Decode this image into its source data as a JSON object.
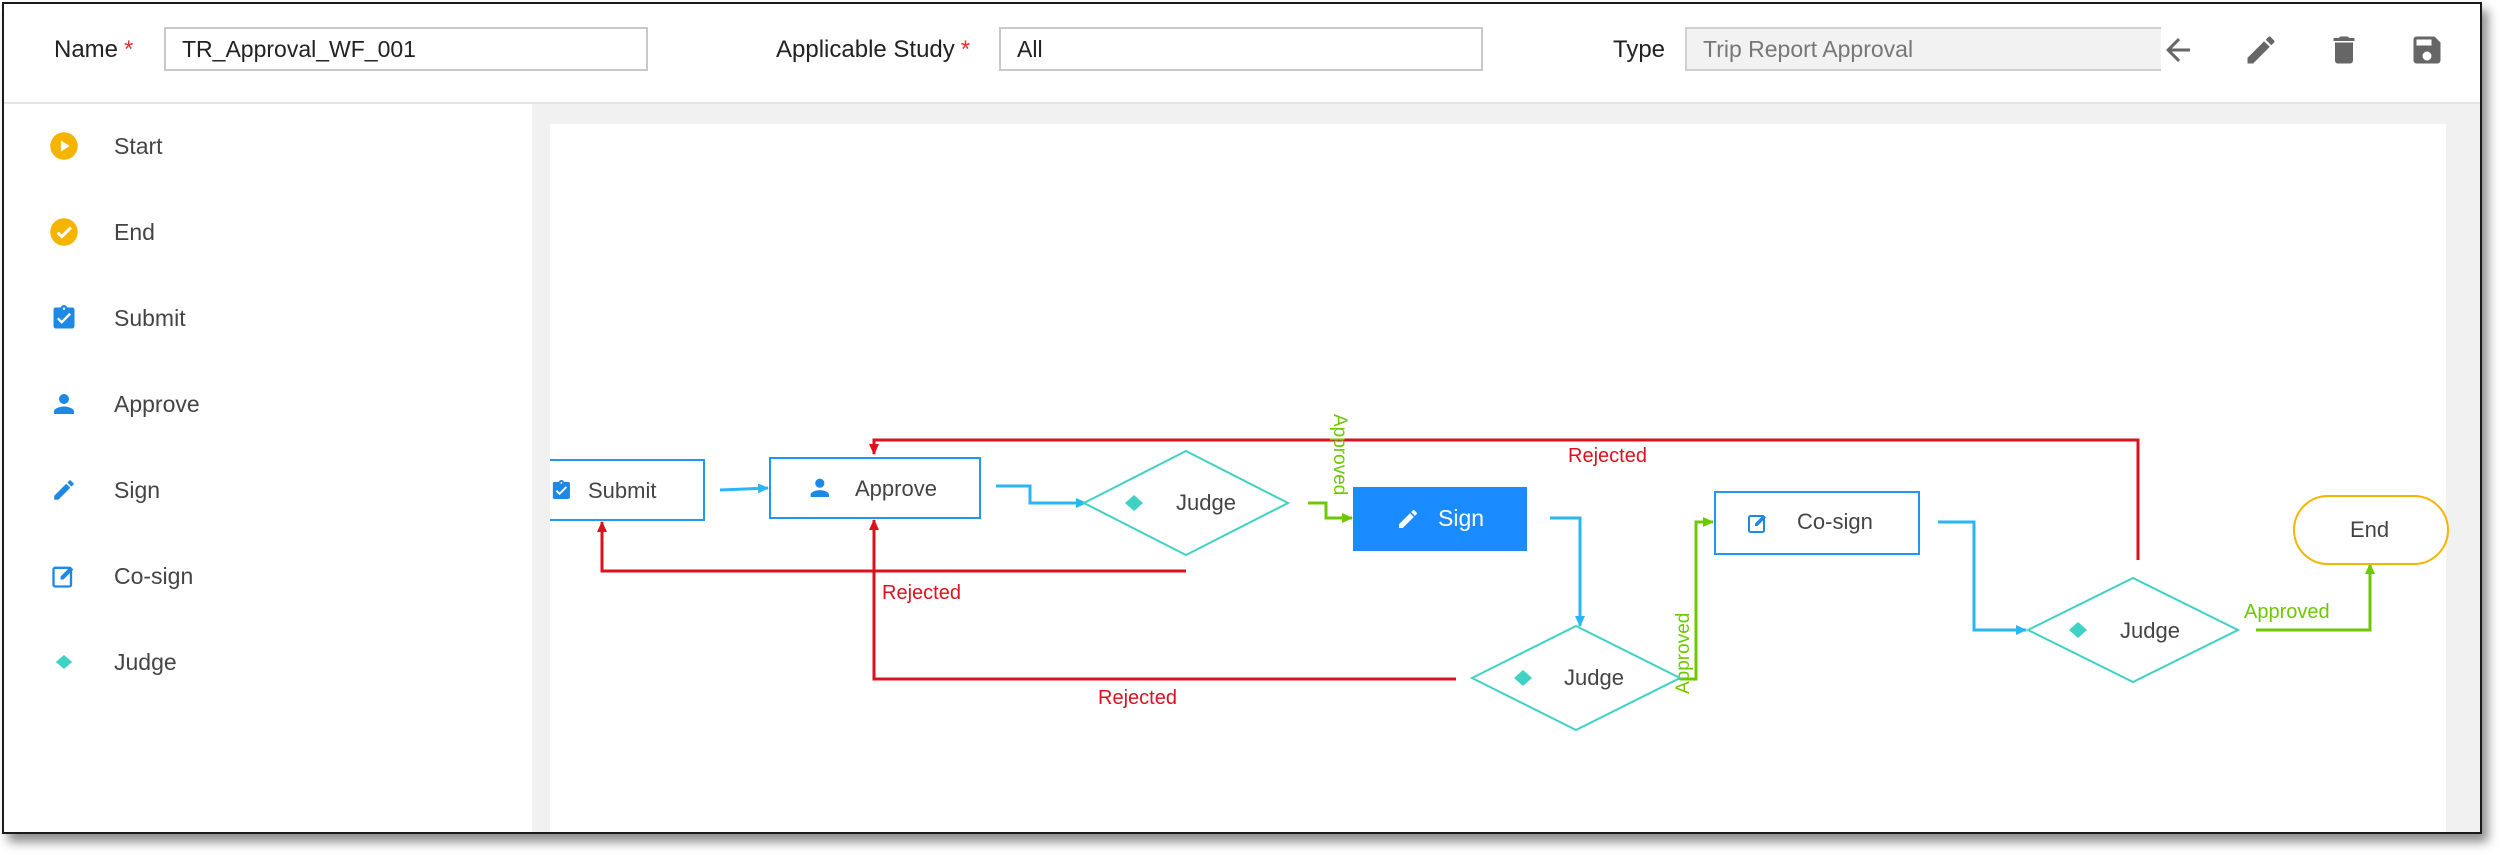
{
  "header": {
    "name_label": "Name",
    "name_value": "TR_Approval_WF_001",
    "study_label": "Applicable Study",
    "study_value": "All",
    "type_label": "Type",
    "type_value": "Trip Report Approval",
    "required_mark": "*"
  },
  "toolbar": {
    "back_icon": "arrow-left-icon",
    "edit_icon": "pencil-icon",
    "delete_icon": "trash-icon",
    "save_icon": "floppy-disk-icon"
  },
  "palette": {
    "items": [
      {
        "label": "Start",
        "icon": "play-circle-icon"
      },
      {
        "label": "End",
        "icon": "check-circle-icon"
      },
      {
        "label": "Submit",
        "icon": "clipboard-check-icon"
      },
      {
        "label": "Approve",
        "icon": "person-icon"
      },
      {
        "label": "Sign",
        "icon": "pencil-icon"
      },
      {
        "label": "Co-sign",
        "icon": "edit-square-icon"
      },
      {
        "label": "Judge",
        "icon": "diamond-icon"
      }
    ]
  },
  "flow": {
    "nodes": {
      "submit": "Submit",
      "approve": "Approve",
      "judge1": "Judge",
      "sign": "Sign",
      "judge2": "Judge",
      "cosign": "Co-sign",
      "judge3": "Judge",
      "end": "End"
    },
    "edges": {
      "approved_1": "Approved",
      "approved_2": "Approved",
      "approved_3": "Approved",
      "rejected_1": "Rejected",
      "rejected_2": "Rejected",
      "rejected_3": "Rejected"
    }
  },
  "colors": {
    "accent": "#2196f3",
    "node_border": "#2196f3",
    "judge_border": "#3fd1c4",
    "judge_fill": "#3fd1c4",
    "connector": "#29b6f6",
    "approved": "#6cc800",
    "rejected": "#d9121e",
    "start_end": "#f5b400",
    "sign_fill": "#1a8cff"
  }
}
